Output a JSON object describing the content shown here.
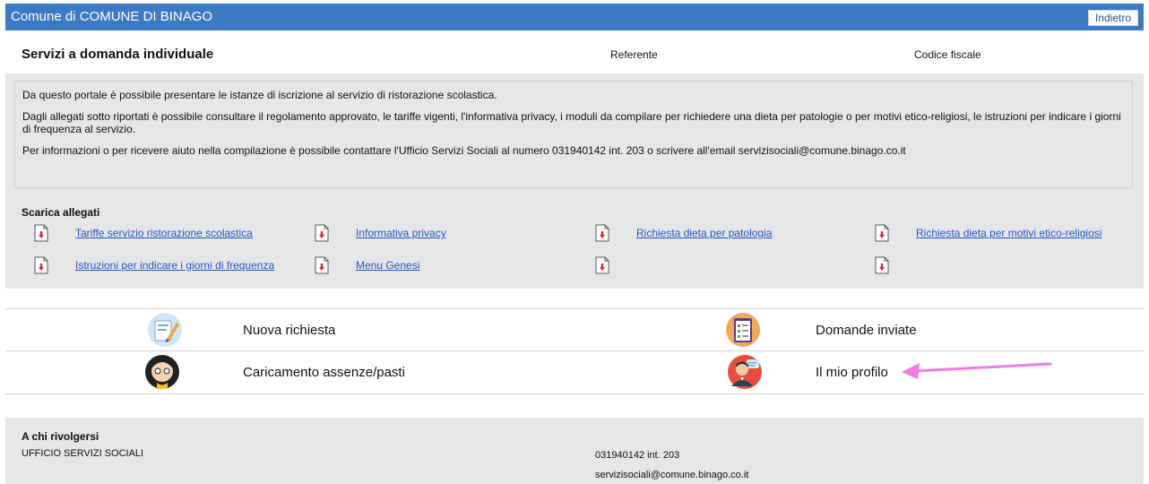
{
  "topbar": {
    "title": "Comune di COMUNE DI BINAGO",
    "back_label": "Indietro"
  },
  "header": {
    "service_title": "Servizi a domanda individuale",
    "referente_label": "Referente",
    "codice_fiscale_label": "Codice fiscale"
  },
  "description": {
    "p1": "Da questo portale è possibile presentare le istanze di iscrizione al servizio di ristorazione scolastica.",
    "p2": "Dagli allegati sotto riportati è possibile consultare il regolamento approvato, le tariffe vigenti, l'informativa privacy, i moduli da compilare per richiedere una dieta per patologie o per motivi etico-religiosi, le istruzioni per indicare i giorni di frequenza al servizio.",
    "p3": "Per informazioni o per ricevere aiuto nella compilazione è possibile contattare l'Ufficio Servizi Sociali al numero 031940142 int. 203 o scrivere all'email servizisociali@comune.binago.co.it"
  },
  "attachments": {
    "title": "Scarica allegati",
    "items": [
      "Tariffe servizio ristorazione scolastica",
      "Informativa privacy",
      "Richiesta dieta per patologia",
      "Richiesta dieta per motivi etico-religiosi",
      "Istruzioni per indicare i giorni di frequenza",
      "Menu Genesi",
      "",
      ""
    ]
  },
  "menu": {
    "new_request": "Nuova richiesta",
    "sent_requests": "Domande inviate",
    "absences": "Caricamento assenze/pasti",
    "profile": "Il mio profilo"
  },
  "contact": {
    "title": "A chi rivolgersi",
    "office": "UFFICIO SERVIZI SOCIALI",
    "phone": "031940142 int. 203",
    "email": "servizisociali@comune.binago.co.it"
  },
  "colors": {
    "topbar": "#3d79c4",
    "link": "#1f57c9",
    "panel": "#e6e6e6",
    "arrow": "#f07ce0",
    "pdf_red": "#d9262b"
  }
}
